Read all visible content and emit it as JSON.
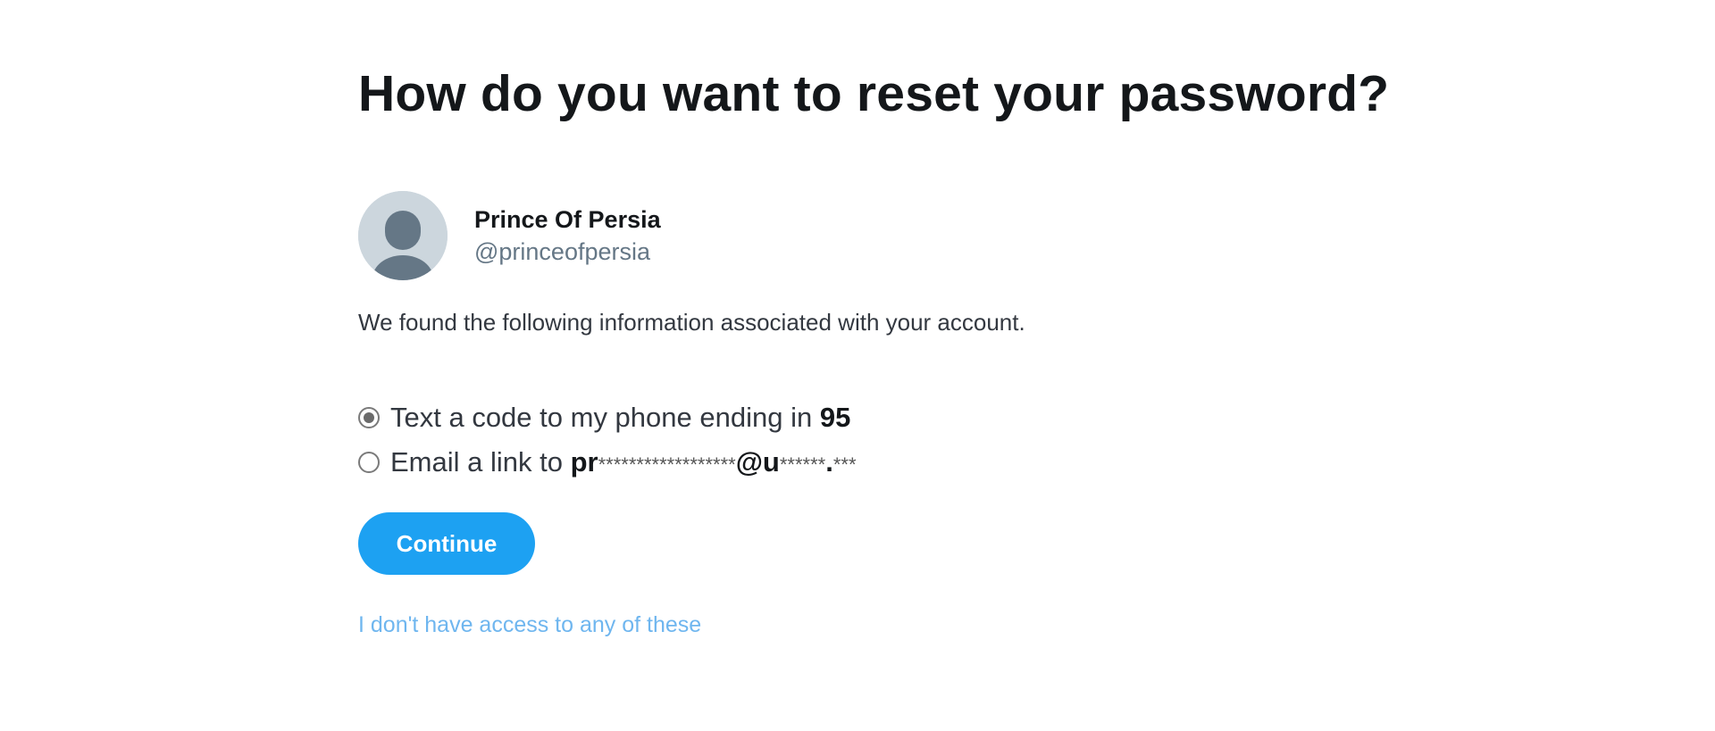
{
  "heading": "How do you want to reset your password?",
  "account": {
    "name": "Prince Of Persia",
    "handle": "@princeofpersia",
    "avatar_icon": "default-avatar-icon"
  },
  "found_text": "We found the following information associated with your account.",
  "options": [
    {
      "label_prefix": "Text a code to my phone ending in ",
      "label_bold": "95",
      "label_suffix": "",
      "checked": true
    },
    {
      "label_prefix": "Email a link to ",
      "label_bold": "pr",
      "label_mask": "******************",
      "label_bold2": "@u",
      "label_mask2": "******",
      "label_bold3": ".",
      "label_mask3": "***",
      "checked": false
    }
  ],
  "continue_label": "Continue",
  "no_access_link": "I don't have access to any of these",
  "colors": {
    "accent": "#1da1f2",
    "link": "#6fb6ef",
    "avatar_bg": "#ccd6dd",
    "avatar_figure": "#657786"
  }
}
